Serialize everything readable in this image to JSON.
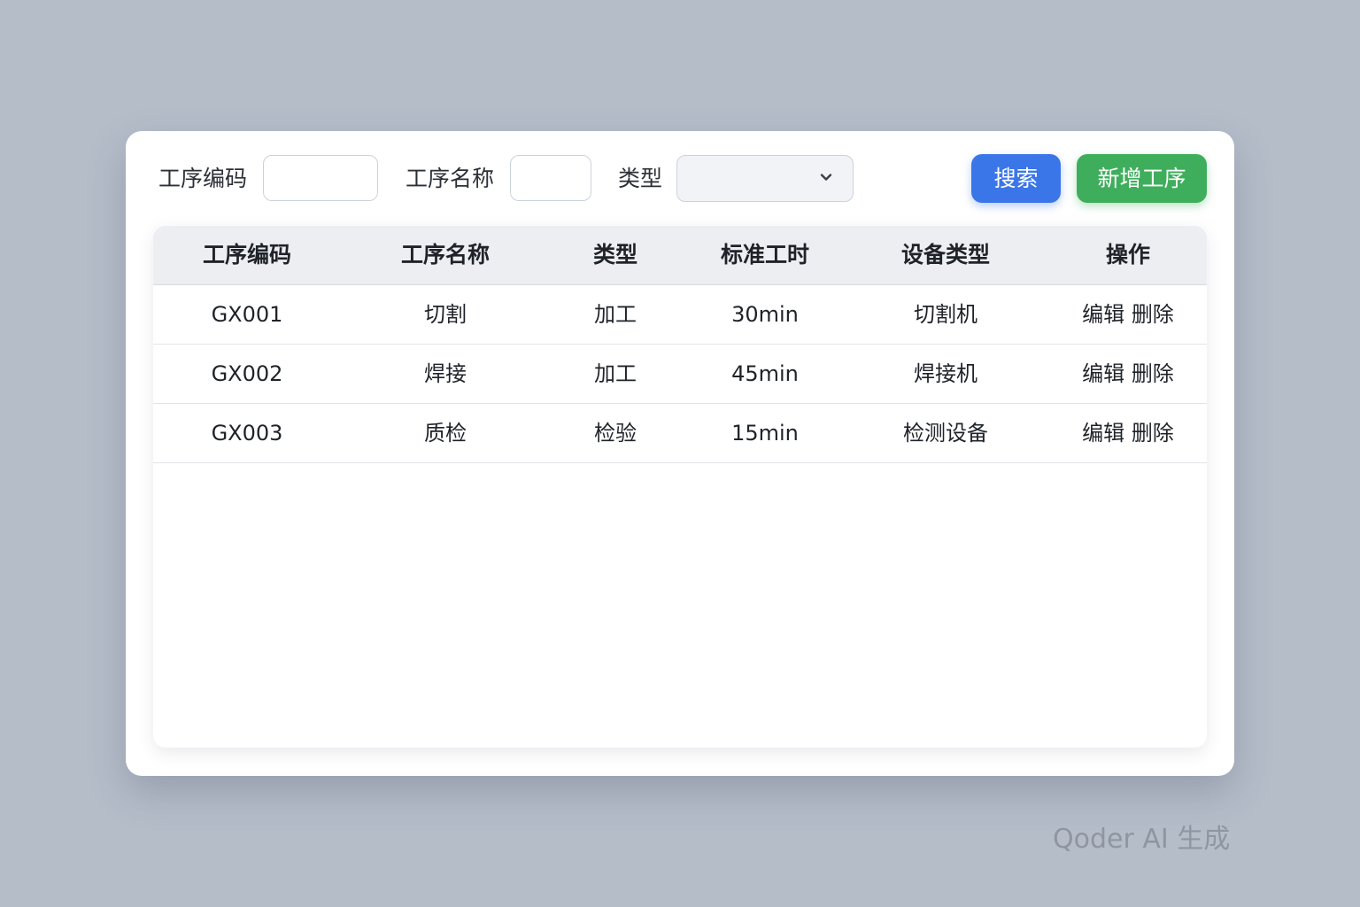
{
  "filters": {
    "process_code_label": "工序编码",
    "process_code_value": "",
    "process_name_label": "工序名称",
    "process_name_value": "",
    "type_label": "类型",
    "type_selected": ""
  },
  "buttons": {
    "search": "搜索",
    "add_process": "新增工序"
  },
  "table": {
    "columns": [
      "工序编码",
      "工序名称",
      "类型",
      "标准工时",
      "设备类型",
      "操作"
    ],
    "rows": [
      {
        "code": "GX001",
        "name": "切割",
        "type": "加工",
        "std_time": "30min",
        "equipment": "切割机",
        "edit": "编辑",
        "delete": "删除"
      },
      {
        "code": "GX002",
        "name": "焊接",
        "type": "加工",
        "std_time": "45min",
        "equipment": "焊接机",
        "edit": "编辑",
        "delete": "删除"
      },
      {
        "code": "GX003",
        "name": "质检",
        "type": "检验",
        "std_time": "15min",
        "equipment": "检测设备",
        "edit": "编辑",
        "delete": "删除"
      }
    ]
  },
  "watermark": "Qoder AI 生成",
  "colors": {
    "search_button": "#3b76e8",
    "add_button": "#3fae5c",
    "header_background": "#eceef2",
    "page_background": "#b5bdc9"
  },
  "icons": {
    "select_arrow": "chevron-down-icon"
  }
}
